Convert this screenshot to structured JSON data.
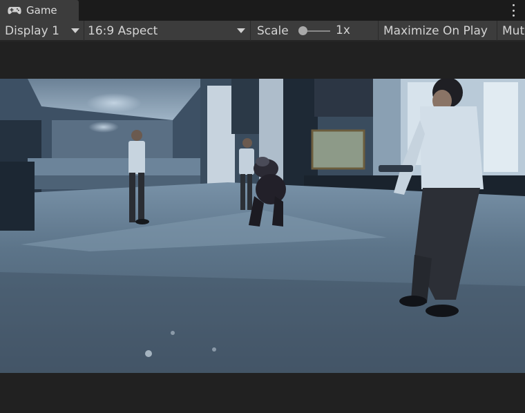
{
  "tab": {
    "title": "Game",
    "icon": "gamepad-icon"
  },
  "toolbar": {
    "display_value": "Display 1",
    "aspect_value": "16:9 Aspect",
    "scale_label": "Scale",
    "scale_value": "1x",
    "scale_level": 0.0,
    "maximize_label": "Maximize On Play",
    "mute_label": "Mut"
  },
  "colors": {
    "tab_bg": "#3c3c3c",
    "tabstrip_bg": "#1b1b1b",
    "toolbar_bg": "#3c3c3c",
    "letterbox_bg": "#212121",
    "text": "#d4d4d4"
  }
}
